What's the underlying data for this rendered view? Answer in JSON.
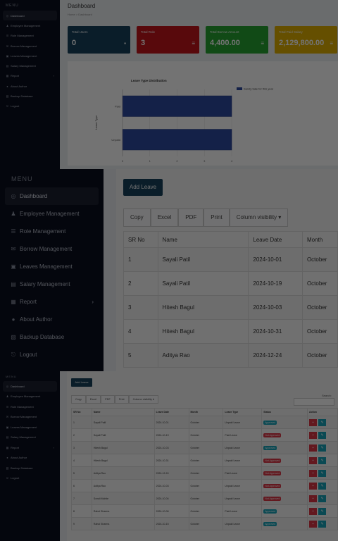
{
  "top": {
    "menu_header": "MENU",
    "nav": [
      "Dashboard",
      "Employee Management",
      "Role Management",
      "Borrow Management",
      "Leaves Management",
      "Salary Management",
      "Report",
      "About Author",
      "Backup Database",
      "Logout"
    ],
    "title": "Dashboard",
    "breadcrumb": [
      "Home",
      "Dashboard"
    ],
    "cards": [
      {
        "label": "Total Users",
        "value": "0",
        "color": "#17425c"
      },
      {
        "label": "Total Role",
        "value": "3",
        "color": "#c4161c"
      },
      {
        "label": "Total Borrow Amount",
        "value": "4,400.00",
        "color": "#26a532"
      },
      {
        "label": "Total Paid Salary",
        "value": "2,129,800.00",
        "color": "#e0b000"
      }
    ],
    "chart_data": {
      "type": "bar",
      "title": "Leave Type Distribution",
      "ylabel": "Leave Type",
      "categories": [
        "Paid",
        "Unpaid"
      ],
      "series": [
        {
          "name": "Sandy take for this year",
          "values": [
            4,
            4
          ]
        }
      ],
      "xlim": [
        0,
        4
      ],
      "xticks": [
        "0",
        "1",
        "2",
        "3",
        "4"
      ]
    }
  },
  "mid": {
    "menu_header": "MENU",
    "nav": [
      "Dashboard",
      "Employee Management",
      "Role Management",
      "Borrow Management",
      "Leaves Management",
      "Salary Management",
      "Report",
      "About Author",
      "Backup Database",
      "Logout"
    ],
    "add_button": "Add Leave",
    "buttons": [
      "Copy",
      "Excel",
      "PDF",
      "Print",
      "Column visibility"
    ],
    "headers": [
      "SR No",
      "Name",
      "Leave Date",
      "Month"
    ],
    "rows": [
      [
        "1",
        "Sayali Patil",
        "2024-10-01",
        "October"
      ],
      [
        "2",
        "Sayali Patil",
        "2024-10-19",
        "October"
      ],
      [
        "3",
        "Hitesh Bagul",
        "2024-10-03",
        "October"
      ],
      [
        "4",
        "Hitesh Bagul",
        "2024-10-31",
        "October"
      ],
      [
        "5",
        "Aditya Rao",
        "2024-12-24",
        "October"
      ]
    ]
  },
  "bottom": {
    "menu_header": "MENU",
    "nav": [
      "Dashboard",
      "Employee Management",
      "Role Management",
      "Borrow Management",
      "Leaves Management",
      "Salary Management",
      "Report",
      "About Author",
      "Backup Database",
      "Logout"
    ],
    "add_button": "Add Leave",
    "buttons": [
      "Copy",
      "Excel",
      "PDF",
      "Print",
      "Column visibility"
    ],
    "search_label": "Search:",
    "headers": [
      "SR No",
      "Name",
      "Leave Date",
      "Month",
      "Leave Type",
      "Status",
      "Action"
    ],
    "rows": [
      [
        "1",
        "Sayali Patil",
        "2024-10-01",
        "October",
        "Unpaid Leave",
        "Approved"
      ],
      [
        "2",
        "Sayali Patil",
        "2024-10-19",
        "October",
        "Paid Leave",
        "Not Approved"
      ],
      [
        "3",
        "Hitesh Bagul",
        "2024-10-03",
        "October",
        "Unpaid Leave",
        "Approved"
      ],
      [
        "4",
        "Hitesh Bagul",
        "2024-10-31",
        "October",
        "Unpaid Leave",
        "Not Approved"
      ],
      [
        "5",
        "Aditya Rao",
        "2024-12-24",
        "October",
        "Paid Leave",
        "Not Approved"
      ],
      [
        "6",
        "Aditya Rao",
        "2024-10-03",
        "October",
        "Unpaid Leave",
        "Not Approved"
      ],
      [
        "7",
        "Sonali Mohite",
        "2024-10-04",
        "October",
        "Unpaid Leave",
        "Not Approved"
      ],
      [
        "8",
        "Rahul Sharma",
        "2024-10-06",
        "October",
        "Paid Leave",
        "Approved"
      ],
      [
        "9",
        "Rahul Sharma",
        "2024-10-15",
        "October",
        "Unpaid Leave",
        "Approved"
      ]
    ]
  }
}
